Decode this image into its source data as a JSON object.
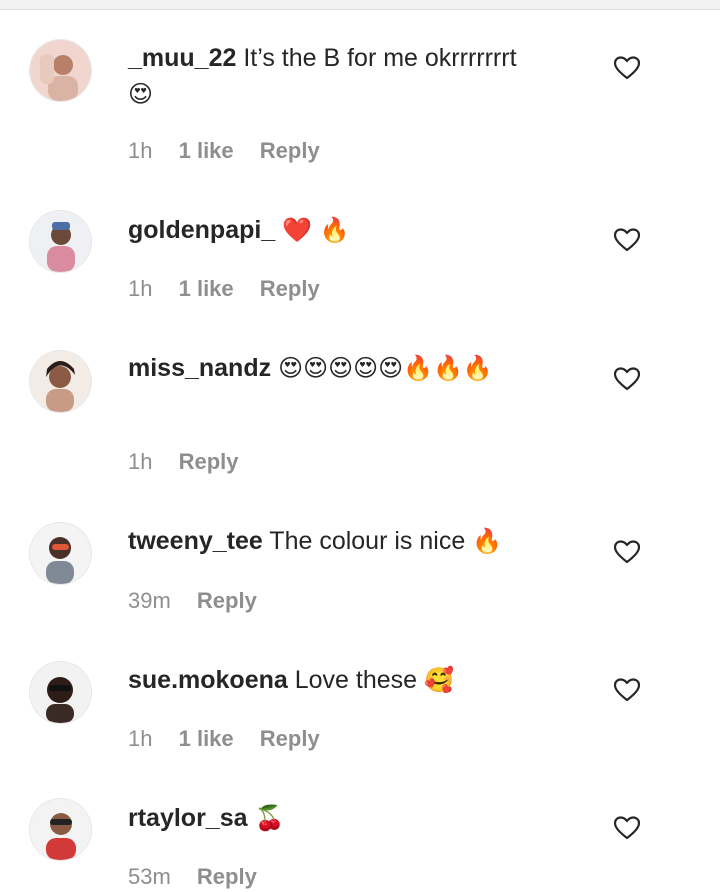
{
  "comments": [
    {
      "username": "_muu_22",
      "text": "It’s the B for me okrrrrrrrt",
      "emoji": "😍",
      "time": "1h",
      "likes": "1 like",
      "reply": "Reply"
    },
    {
      "username": "goldenpapi_",
      "text": "",
      "emoji": "❤️ 🔥",
      "time": "1h",
      "likes": "1 like",
      "reply": "Reply"
    },
    {
      "username": "miss_nandz",
      "text": "",
      "emoji": "😍😍😍😍😍🔥🔥🔥",
      "time": "1h",
      "likes": "",
      "reply": "Reply"
    },
    {
      "username": "tweeny_tee",
      "text": "The colour is nice",
      "emoji": "🔥",
      "time": "39m",
      "likes": "",
      "reply": "Reply"
    },
    {
      "username": "sue.mokoena",
      "text": "Love these",
      "emoji": "🥰",
      "time": "1h",
      "likes": "1 like",
      "reply": "Reply"
    },
    {
      "username": "rtaylor_sa",
      "text": "",
      "emoji": "🍒",
      "time": "53m",
      "likes": "",
      "reply": "Reply"
    }
  ],
  "icons": {
    "like": "heart-outline-icon",
    "avatar": "profile-picture"
  },
  "colors": {
    "text": "#262626",
    "meta": "#8e8e8e"
  }
}
